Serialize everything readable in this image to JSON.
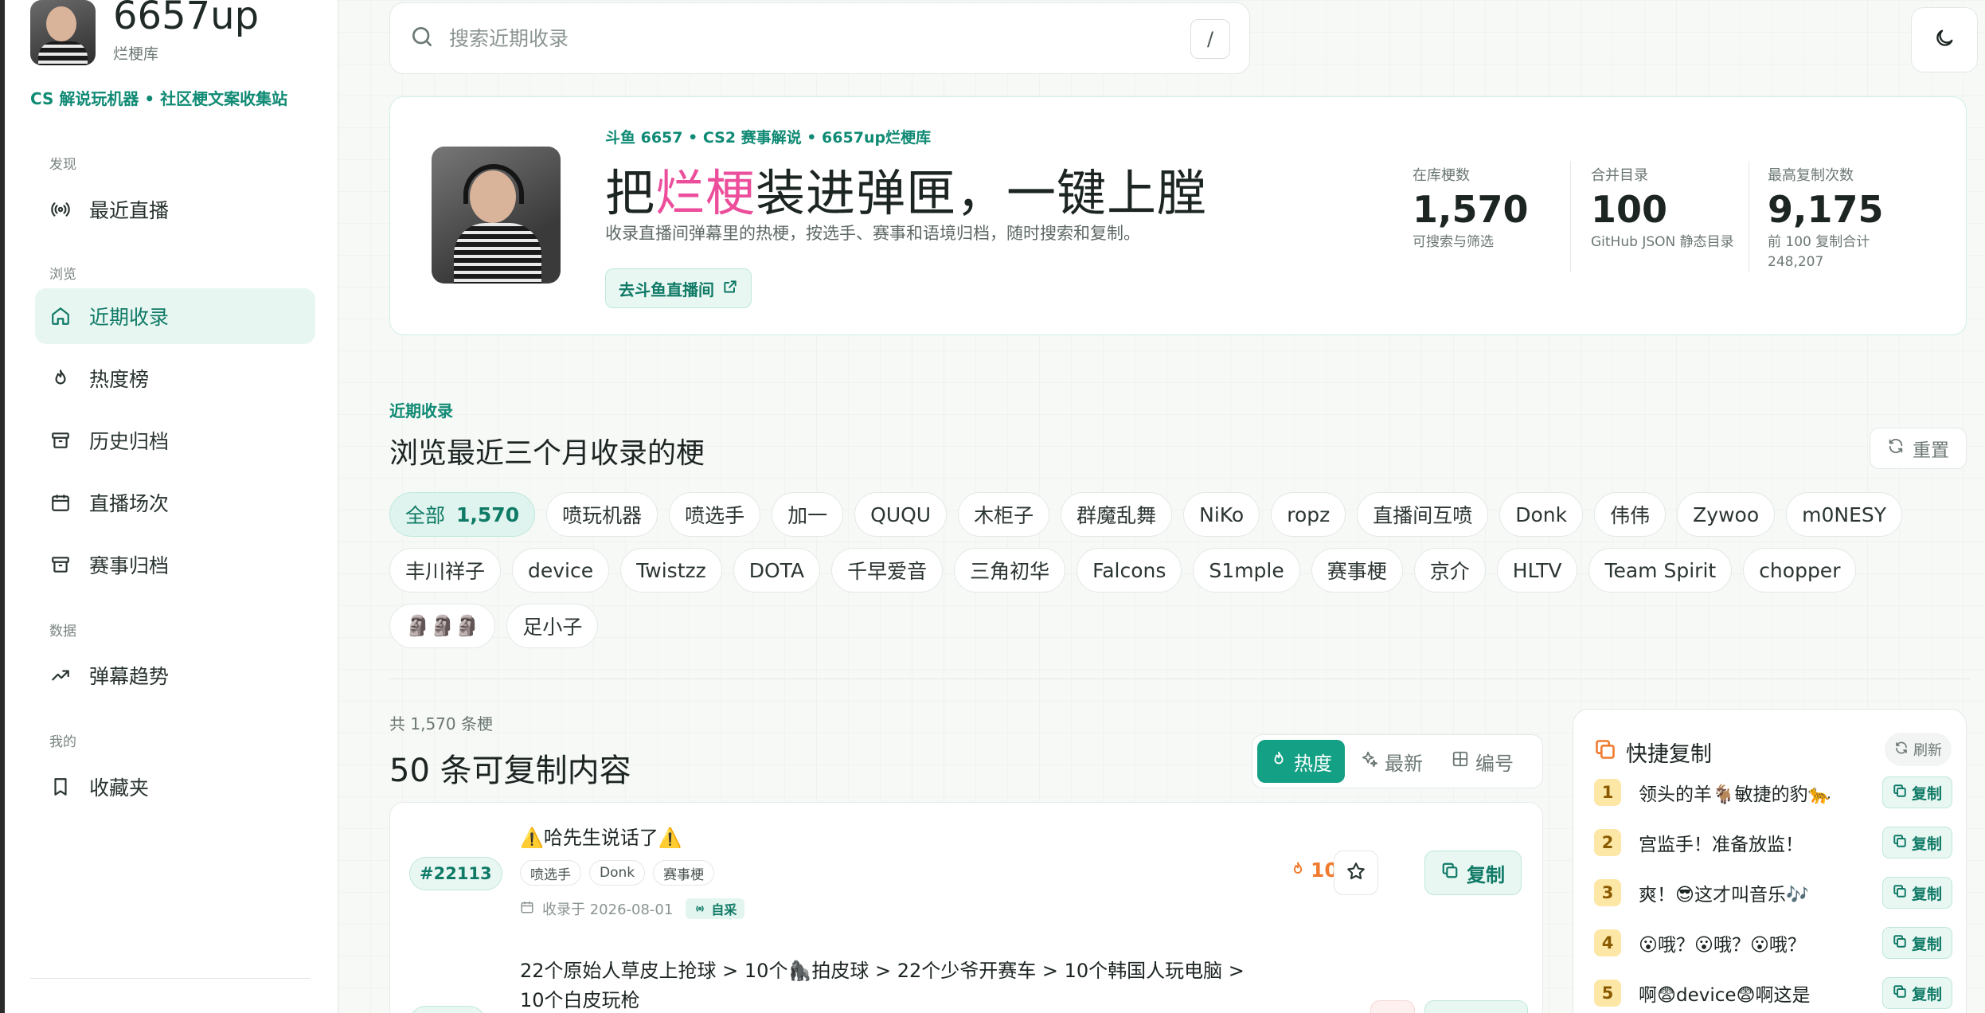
{
  "app": {
    "name": "6657up",
    "subtitle": "烂梗库",
    "tagline": "CS 解说玩机器 • 社区梗文案收集站"
  },
  "sidebar": {
    "sections": [
      {
        "label": "发现",
        "items": [
          {
            "label": "最近直播",
            "icon": "broadcast-icon"
          }
        ]
      },
      {
        "label": "浏览",
        "items": [
          {
            "label": "近期收录",
            "icon": "home-icon",
            "active": true
          },
          {
            "label": "热度榜",
            "icon": "flame-icon"
          },
          {
            "label": "历史归档",
            "icon": "archive-icon"
          },
          {
            "label": "直播场次",
            "icon": "calendar-icon"
          },
          {
            "label": "赛事归档",
            "icon": "archive-icon"
          }
        ]
      },
      {
        "label": "数据",
        "items": [
          {
            "label": "弹幕趋势",
            "icon": "trend-icon"
          }
        ]
      },
      {
        "label": "我的",
        "items": [
          {
            "label": "收藏夹",
            "icon": "bookmark-icon"
          }
        ]
      }
    ]
  },
  "search": {
    "placeholder": "搜索近期收录",
    "shortcut": "/"
  },
  "hero": {
    "kicker": "斗鱼 6657 • CS2 赛事解说 • 6657up烂梗库",
    "title_prefix": "把",
    "title_highlight": "烂梗",
    "title_suffix": "装进弹匣，一键上膛",
    "description": "收录直播间弹幕里的热梗，按选手、赛事和语境归档，随时搜索和复制。",
    "button_label": "去斗鱼直播间",
    "stats": [
      {
        "label": "在库梗数",
        "value": "1,570",
        "sub": "可搜索与筛选"
      },
      {
        "label": "合并目录",
        "value": "100",
        "sub": "GitHub JSON 静态目录"
      },
      {
        "label": "最高复制次数",
        "value": "9,175",
        "sub": "前 100 复制合计\n248,207"
      }
    ]
  },
  "section": {
    "kicker": "近期收录",
    "title": "浏览最近三个月收录的梗",
    "reset_label": "重置"
  },
  "filters": {
    "all_label": "全部",
    "all_count": "1,570",
    "tags": [
      "喷玩机器",
      "喷选手",
      "加一",
      "QUQU",
      "木柜子",
      "群魔乱舞",
      "NiKo",
      "ropz",
      "直播间互喷",
      "Donk",
      "伟伟",
      "Zywoo",
      "m0NESY",
      "丰川祥子",
      "device",
      "Twistzz",
      "DOTA",
      "千早爱音",
      "三角初华",
      "Falcons",
      "S1mple",
      "赛事梗",
      "京介",
      "HLTV",
      "Team Spirit",
      "chopper",
      "🗿🗿🗿",
      "足小子"
    ]
  },
  "list": {
    "count_text": "共 1,570 条梗",
    "title": "50 条可复制内容",
    "sort": [
      {
        "label": "热度",
        "icon": "flame-icon",
        "active": true
      },
      {
        "label": "最新",
        "icon": "sparkle-icon"
      },
      {
        "label": "编号",
        "icon": "grid-icon"
      }
    ],
    "items": [
      {
        "id": "#22113",
        "text": "⚠️哈先生说话了⚠️",
        "tags": [
          "喷选手",
          "Donk",
          "赛事梗"
        ],
        "date": "收录于 2026-08-01",
        "source": "自采",
        "heat": "1074",
        "copy_label": "复制"
      },
      {
        "text": "22个原始人草皮上抢球 > 10个🦍拍皮球 > 22个少爷开赛车 > 10个韩国人玩电脑 > 10个白皮玩枪"
      }
    ]
  },
  "quick_copy": {
    "title": "快捷复制",
    "refresh_label": "刷新",
    "copy_label": "复制",
    "items": [
      {
        "rank": "1",
        "text": "领头的羊🐐敏捷的豹🐆"
      },
      {
        "rank": "2",
        "text": "宫监手！准备放监！"
      },
      {
        "rank": "3",
        "text": "爽！😎这才叫音乐🎶"
      },
      {
        "rank": "4",
        "text": "😮哦？😮哦？😮哦？"
      },
      {
        "rank": "5",
        "text": "啊😨device😨啊这是"
      }
    ]
  }
}
